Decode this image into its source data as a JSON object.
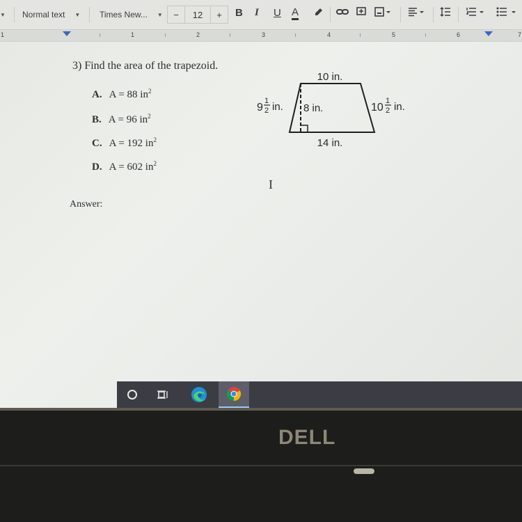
{
  "toolbar": {
    "style_select": "Normal text",
    "font_select": "Times New...",
    "font_size": "12",
    "font_size_minus": "−",
    "font_size_plus": "+",
    "bold": "B",
    "italic": "I",
    "underline": "U",
    "text_color": "A",
    "icons": [
      "highlighter-icon",
      "link-icon",
      "comment-icon",
      "image-icon",
      "align-icon",
      "line-spacing-icon",
      "numbered-list-icon",
      "bulleted-list-icon"
    ]
  },
  "ruler": {
    "numbers": [
      "1",
      "2",
      "3",
      "4",
      "5",
      "6",
      "7"
    ],
    "left_label": "1"
  },
  "question": {
    "text": "3)  Find the area of the trapezoid.",
    "options": [
      {
        "letter": "A.",
        "text": "A = 88 in",
        "exp": "2"
      },
      {
        "letter": "B.",
        "text": "A = 96 in",
        "exp": "2"
      },
      {
        "letter": "C.",
        "text": "A = 192 in",
        "exp": "2"
      },
      {
        "letter": "D.",
        "text": "A = 602 in",
        "exp": "2"
      }
    ],
    "answer_label": "Answer:"
  },
  "diagram": {
    "top": "10 in.",
    "bottom": "14 in.",
    "height": "8 in.",
    "left_whole": "9",
    "left_num": "1",
    "left_den": "2",
    "left_unit": "in.",
    "right_whole": "10",
    "right_num": "1",
    "right_den": "2",
    "right_unit": "in."
  },
  "taskbar": {
    "items": [
      "cortana-search",
      "task-view",
      "edge",
      "chrome"
    ],
    "active": "chrome"
  },
  "bezel": {
    "brand": "DELL"
  },
  "colors": {
    "accent_blue": "#3f63c8",
    "taskbar": "#3c3c44",
    "bezel": "#1d1d1b"
  }
}
